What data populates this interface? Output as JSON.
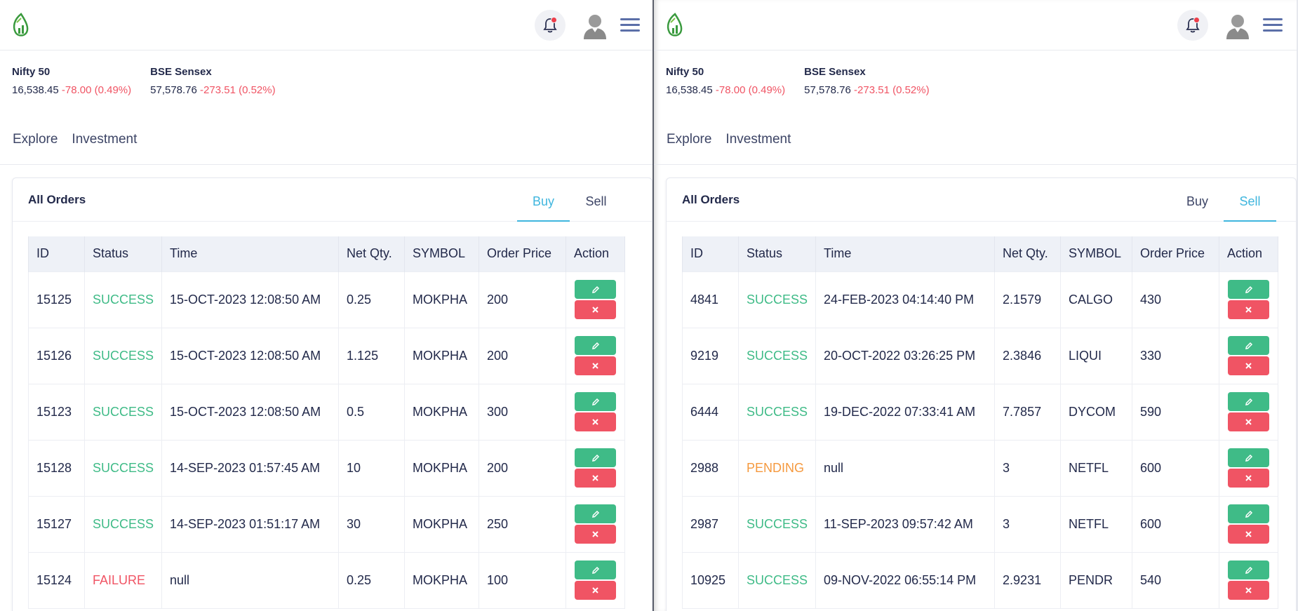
{
  "left": {
    "indices": [
      {
        "name": "Nifty 50",
        "value": "16,538.45",
        "change": "-78.00 (0.49%)"
      },
      {
        "name": "BSE Sensex",
        "value": "57,578.76",
        "change": "-273.51 (0.52%)"
      }
    ],
    "nav": [
      "Explore",
      "Investment"
    ],
    "card_title": "All Orders",
    "tabs": [
      "Buy",
      "Sell"
    ],
    "active_tab": "Buy",
    "columns": [
      "ID",
      "Status",
      "Time",
      "Net Qty.",
      "SYMBOL",
      "Order Price",
      "Action"
    ],
    "rows": [
      {
        "id": "15125",
        "status": "SUCCESS",
        "time": "15-OCT-2023 12:08:50 AM",
        "qty": "0.25",
        "symbol": "MOKPHA",
        "price": "200"
      },
      {
        "id": "15126",
        "status": "SUCCESS",
        "time": "15-OCT-2023 12:08:50 AM",
        "qty": "1.125",
        "symbol": "MOKPHA",
        "price": "200"
      },
      {
        "id": "15123",
        "status": "SUCCESS",
        "time": "15-OCT-2023 12:08:50 AM",
        "qty": "0.5",
        "symbol": "MOKPHA",
        "price": "300"
      },
      {
        "id": "15128",
        "status": "SUCCESS",
        "time": "14-SEP-2023 01:57:45 AM",
        "qty": "10",
        "symbol": "MOKPHA",
        "price": "200"
      },
      {
        "id": "15127",
        "status": "SUCCESS",
        "time": "14-SEP-2023 01:51:17 AM",
        "qty": "30",
        "symbol": "MOKPHA",
        "price": "250"
      },
      {
        "id": "15124",
        "status": "FAILURE",
        "time": "null",
        "qty": "0.25",
        "symbol": "MOKPHA",
        "price": "100"
      }
    ]
  },
  "right": {
    "indices": [
      {
        "name": "Nifty 50",
        "value": "16,538.45",
        "change": "-78.00 (0.49%)"
      },
      {
        "name": "BSE Sensex",
        "value": "57,578.76",
        "change": "-273.51 (0.52%)"
      }
    ],
    "nav": [
      "Explore",
      "Investment"
    ],
    "card_title": "All Orders",
    "tabs": [
      "Buy",
      "Sell"
    ],
    "active_tab": "Sell",
    "columns": [
      "ID",
      "Status",
      "Time",
      "Net Qty.",
      "SYMBOL",
      "Order Price",
      "Action"
    ],
    "rows": [
      {
        "id": "4841",
        "status": "SUCCESS",
        "time": "24-FEB-2023 04:14:40 PM",
        "qty": "2.1579",
        "symbol": "CALGO",
        "price": "430"
      },
      {
        "id": "9219",
        "status": "SUCCESS",
        "time": "20-OCT-2022 03:26:25 PM",
        "qty": "2.3846",
        "symbol": "LIQUI",
        "price": "330"
      },
      {
        "id": "6444",
        "status": "SUCCESS",
        "time": "19-DEC-2022 07:33:41 AM",
        "qty": "7.7857",
        "symbol": "DYCOM",
        "price": "590"
      },
      {
        "id": "2988",
        "status": "PENDING",
        "time": "null",
        "qty": "3",
        "symbol": "NETFL",
        "price": "600"
      },
      {
        "id": "2987",
        "status": "SUCCESS",
        "time": "11-SEP-2023 09:57:42 AM",
        "qty": "3",
        "symbol": "NETFL",
        "price": "600"
      },
      {
        "id": "10925",
        "status": "SUCCESS",
        "time": "09-NOV-2022 06:55:14 PM",
        "qty": "2.9231",
        "symbol": "PENDR",
        "price": "540"
      }
    ]
  },
  "colors": {
    "success": "#3fbb87",
    "failure": "#f05464",
    "pending": "#f5993e",
    "accent": "#3fb6de",
    "edit_button": "#3fbb87",
    "delete_button": "#f05464"
  },
  "icons": {
    "logo": "leaf-chart-logo-icon",
    "notification": "bell-icon",
    "profile": "user-avatar-icon",
    "menu": "hamburger-menu-icon",
    "edit": "pencil-icon",
    "delete": "close-icon"
  }
}
